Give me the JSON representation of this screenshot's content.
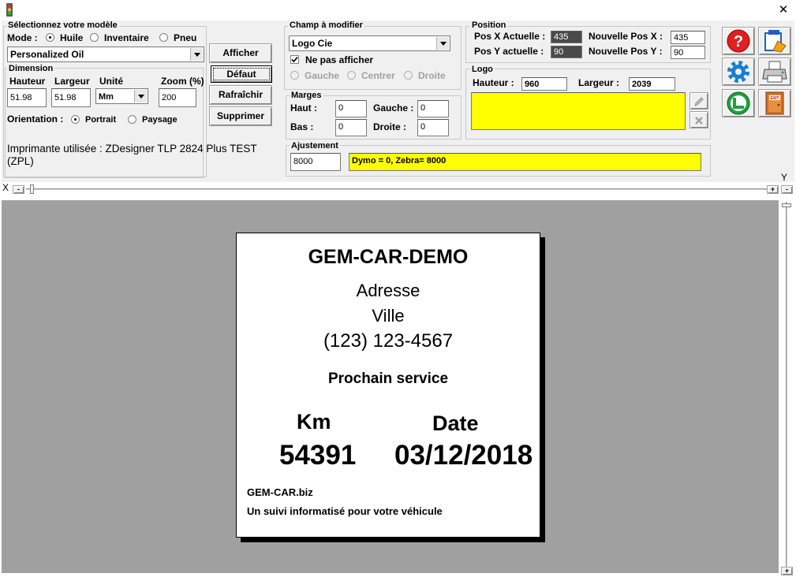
{
  "window": {
    "close_glyph": "✕"
  },
  "model": {
    "group_label": "Sélectionnez votre modèle",
    "mode_label": "Mode :",
    "modes": [
      "Huile",
      "Inventaire",
      "Pneu"
    ],
    "selected_mode": "Huile",
    "model_value": "Personalized Oil"
  },
  "dimension": {
    "group_label": "Dimension",
    "hauteur_label": "Hauteur",
    "largeur_label": "Largeur",
    "unite_label": "Unité",
    "zoom_label": "Zoom (%)",
    "hauteur": "51.98",
    "largeur": "51.98",
    "unite": "Mm",
    "zoom": "200",
    "orientation_label": "Orientation :",
    "portrait": "Portrait",
    "paysage": "Paysage",
    "selected_orientation": "Portrait"
  },
  "buttons": {
    "afficher": "Afficher",
    "defaut": "Défaut",
    "rafraichir": "Rafraîchir",
    "supprimer": "Supprimer"
  },
  "printer": {
    "text": "Imprimante utilisée : ZDesigner TLP 2824 Plus TEST (ZPL)"
  },
  "champ": {
    "group_label": "Champ à modifier",
    "value": "Logo Cie",
    "hide_label": "Ne pas afficher",
    "hide_checked": true,
    "align_gauche": "Gauche",
    "align_centrer": "Centrer",
    "align_droite": "Droite"
  },
  "marges": {
    "group_label": "Marges",
    "haut_label": "Haut :",
    "bas_label": "Bas :",
    "gauche_label": "Gauche :",
    "droite_label": "Droite :",
    "haut": "0",
    "bas": "0",
    "gauche": "0",
    "droite": "0"
  },
  "position": {
    "group_label": "Position",
    "posx_label": "Pos X Actuelle :",
    "posy_label": "Pos Y actuelle :",
    "posx": "435",
    "posy": "90",
    "newx_label": "Nouvelle Pos X :",
    "newy_label": "Nouvelle Pos Y :",
    "newx": "435",
    "newy": "90"
  },
  "logo": {
    "group_label": "Logo",
    "hauteur_label": "Hauteur :",
    "largeur_label": "Largeur :",
    "hauteur": "960",
    "largeur": "2039",
    "preview_color": "#ffff00"
  },
  "ajustement": {
    "group_label": "Ajustement",
    "value": "8000",
    "note": "Dymo = 0, Zebra= 8000"
  },
  "rulers": {
    "x_label": "X",
    "y_label": "Y",
    "minus": "-",
    "plus": "+"
  },
  "icons": [
    "help-icon",
    "settings-icon",
    "refresh-icon",
    "edit-icon",
    "printer-icon",
    "exit-icon"
  ],
  "preview": {
    "company": "GEM-CAR-DEMO",
    "address": "Adresse",
    "city": "Ville",
    "phone": "(123) 123-4567",
    "next_service": "Prochain service",
    "km_label": "Km",
    "km_value": "54391",
    "date_label": "Date",
    "date_value": "03/12/2018",
    "website": "GEM-CAR.biz",
    "tagline": "Un suivi informatisé pour votre véhicule"
  },
  "colors": {
    "panel": "#f0f0f0",
    "canvas": "#a0a0a0",
    "highlight": "#ffff00",
    "dark_field": "#4a4a4a"
  }
}
